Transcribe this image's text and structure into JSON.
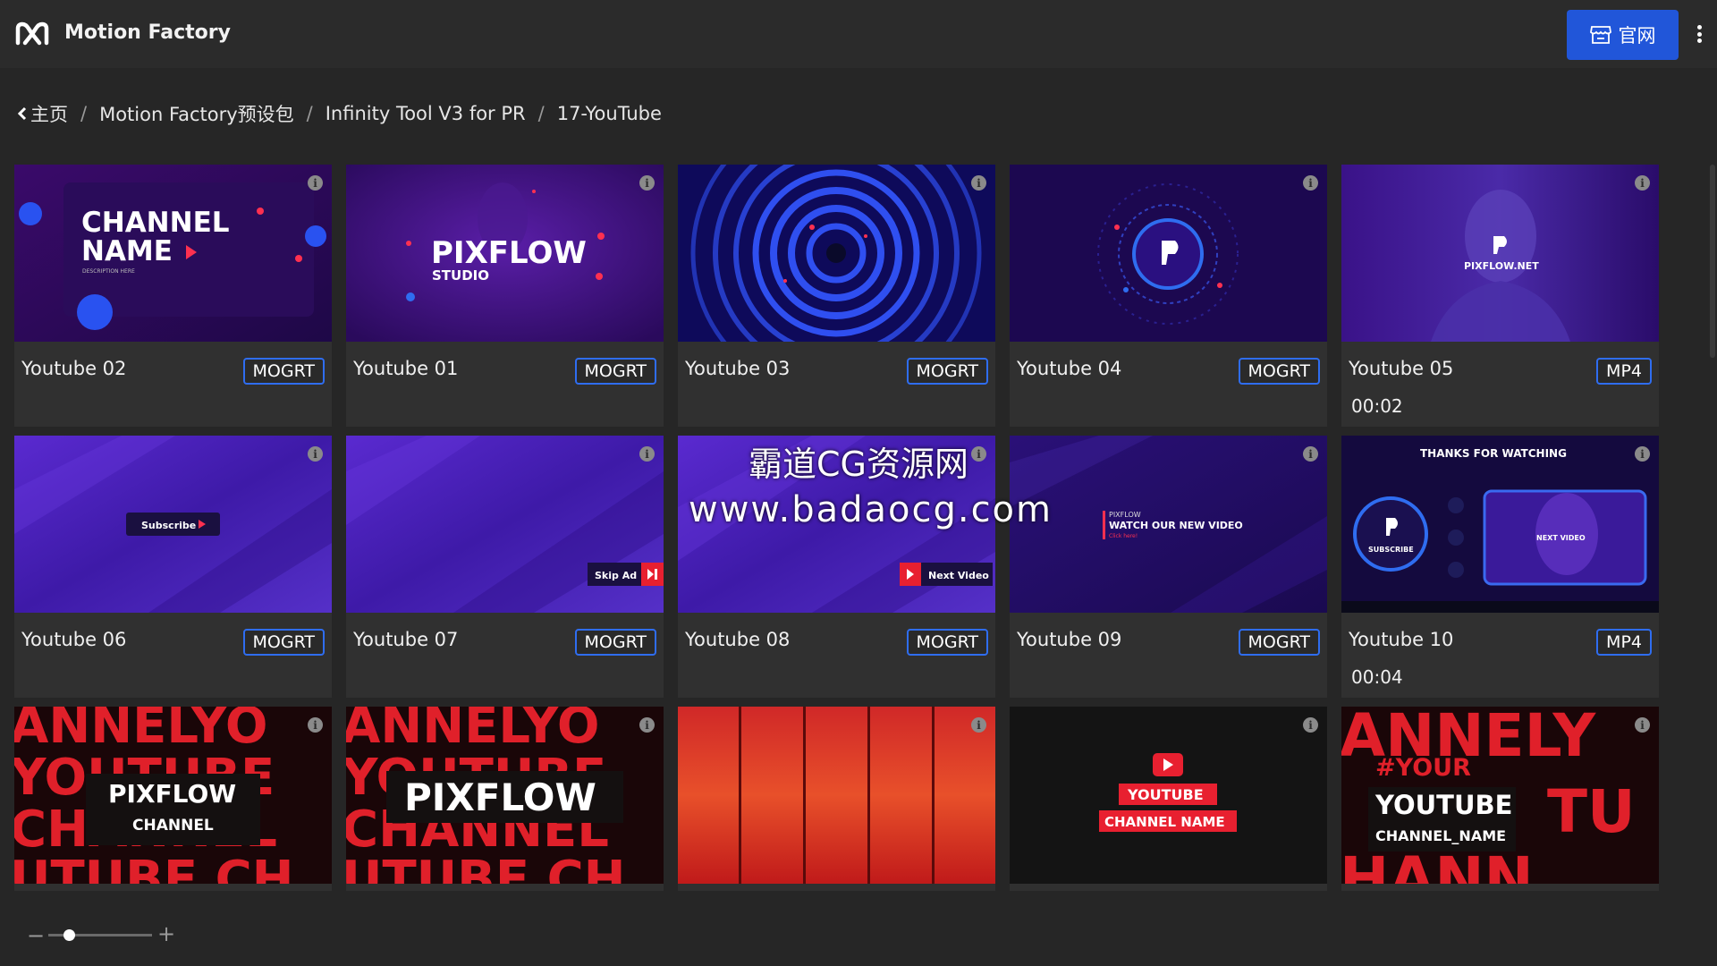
{
  "header": {
    "app_title": "Motion Factory",
    "site_button_label": "官网",
    "accent_color": "#2156d9"
  },
  "breadcrumb": {
    "items": [
      "主页",
      "Motion Factory预设包",
      "Infinity Tool V3 for PR",
      "17-YouTube"
    ]
  },
  "cards": [
    {
      "title": "Youtube 02",
      "badge": "MOGRT",
      "thumb_text": [
        "CHANNEL",
        "NAME",
        "DESCRIPTION HERE"
      ]
    },
    {
      "title": "Youtube 01",
      "badge": "MOGRT",
      "thumb_text": [
        "PIXFLOW",
        "STUDIO"
      ]
    },
    {
      "title": "Youtube 03",
      "badge": "MOGRT",
      "thumb_text": []
    },
    {
      "title": "Youtube 04",
      "badge": "MOGRT",
      "thumb_text": []
    },
    {
      "title": "Youtube 05",
      "badge": "MP4",
      "duration": "00:02",
      "thumb_text": [
        "PIXFLOW.NET"
      ]
    },
    {
      "title": "Youtube 06",
      "badge": "MOGRT",
      "thumb_text": [
        "Subscribe"
      ]
    },
    {
      "title": "Youtube 07",
      "badge": "MOGRT",
      "thumb_text": [
        "Skip Ad"
      ]
    },
    {
      "title": "Youtube 08",
      "badge": "MOGRT",
      "thumb_text": [
        "Next Video"
      ]
    },
    {
      "title": "Youtube 09",
      "badge": "MOGRT",
      "thumb_text": [
        "PIXFLOW",
        "WATCH OUR NEW VIDEO",
        "Click here!"
      ]
    },
    {
      "title": "Youtube 10",
      "badge": "MP4",
      "duration": "00:04",
      "thumb_text": [
        "THANKS FOR WATCHING",
        "SUBSCRIBE",
        "NEXT VIDEO"
      ]
    },
    {
      "thumb_text": [
        "PIXFLOW",
        "CHANNEL",
        "ANNELYO",
        "YOUTUBE",
        "CHANNEL",
        "UTUBE CH"
      ]
    },
    {
      "thumb_text": [
        "PIXFLOW",
        "ANNELYO",
        "YOUTUBE",
        "CHANNEL",
        "UTUBE CH"
      ]
    },
    {
      "thumb_text": []
    },
    {
      "thumb_text": [
        "YOUTUBE",
        "CHANNEL NAME"
      ]
    },
    {
      "thumb_text": [
        "#YOUR",
        "YOUTUBE",
        "CHANNEL_NAME",
        "ANNELY",
        "TU",
        "HANN"
      ]
    }
  ],
  "watermark": {
    "line1": "霸道CG资源网",
    "line2": "www.badaocg.com"
  },
  "zoom": {
    "minus": "−",
    "plus": "+",
    "level": 0.2
  },
  "icons": {
    "logo": "motion-factory-logo-icon",
    "site": "storefront-icon",
    "more": "more-vertical-icon",
    "back": "chevron-left-icon",
    "info": "info-icon"
  }
}
